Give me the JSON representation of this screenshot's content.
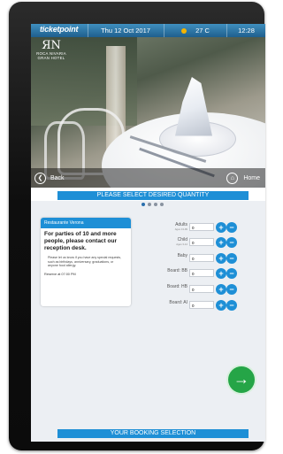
{
  "header": {
    "brand": "ticketpoint",
    "date": "Thu 12 Oct 2017",
    "temperature": "27 C",
    "time": "12:28",
    "weather_icon": "sun-icon"
  },
  "logo": {
    "monogram": "ЯN",
    "name": "ROCA NIVARIA",
    "sub": "GRAN HOTEL"
  },
  "nav": {
    "back_label": "Back",
    "home_label": "Home",
    "back_icon": "❮",
    "home_icon": "⌂"
  },
  "select_banner": "PLEASE SELECT DESIRED QUANTITY",
  "bottom_banner": "YOUR BOOKING SELECTION",
  "pagination": {
    "count": 4,
    "active_index": 0
  },
  "info_card": {
    "title": "Restaurante Verona",
    "lead": "For parties of 10 and more people, please contact our reception desk.",
    "note": "Please let us know if you have any special requests, such as birthdays, anniversary, graduations, or anyone food allergy.",
    "hours": "Reserve at 07:00 PM"
  },
  "quantities": [
    {
      "label": "Adults",
      "sub": "Ages 13-99",
      "value": "0"
    },
    {
      "label": "Child",
      "sub": "Ages 3-12",
      "value": "0"
    },
    {
      "label": "Baby",
      "sub": "",
      "value": "0"
    },
    {
      "label": "Board: BB",
      "sub": "",
      "value": "0"
    },
    {
      "label": "Board: HB",
      "sub": "",
      "value": "0"
    },
    {
      "label": "Board: AI",
      "sub": "",
      "value": "0"
    }
  ],
  "buttons": {
    "plus": "+",
    "minus": "−",
    "next": "→"
  },
  "colors": {
    "accent": "#1e8fd6",
    "next": "#25a547",
    "topbar": "#1f5f8d"
  }
}
